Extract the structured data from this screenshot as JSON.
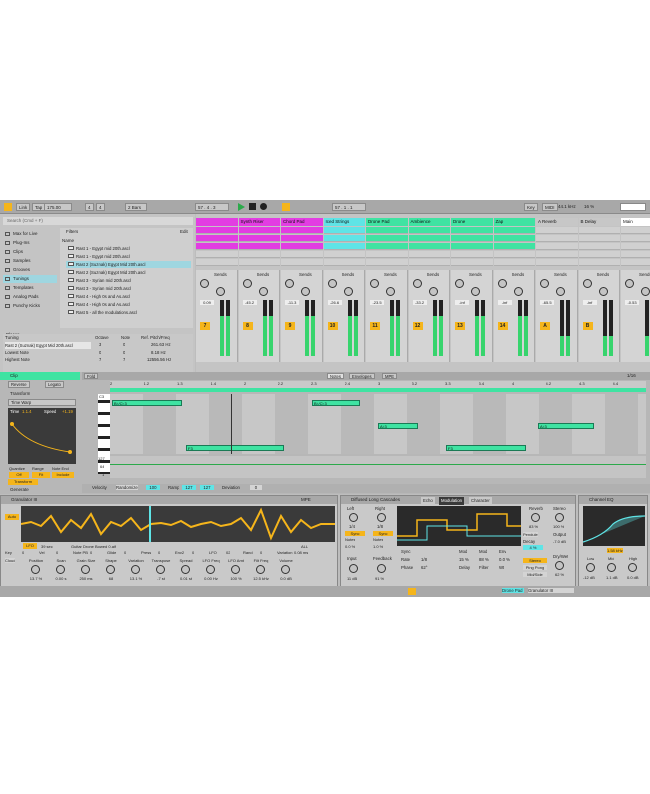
{
  "transport": {
    "link": "Link",
    "tap": "Tap",
    "tempo": "175.00",
    "sig_num": "4",
    "sig_den": "4",
    "quantize": "2 Bars",
    "position": "57 . 4 . 3",
    "position2": "57 . 1 . 1",
    "key": "Key",
    "midi": "MIDI",
    "sample_rate": "44.1 kHz",
    "cpu": "16 %"
  },
  "browser": {
    "search_placeholder": "Search (Cmd + F)",
    "filters": "Filters",
    "edit": "Edit",
    "column_name": "Name",
    "places": [
      {
        "label": "Max for Live"
      },
      {
        "label": "Plug-Ins"
      },
      {
        "label": "Clips"
      },
      {
        "label": "Samples"
      },
      {
        "label": "Grooves"
      },
      {
        "label": "Tunings"
      },
      {
        "label": "Templates"
      },
      {
        "label": "Analog Pads"
      },
      {
        "label": "Punchy Kicks"
      }
    ],
    "places_header": "Places",
    "places_footer": "Packs",
    "files": [
      {
        "name": "Rast 1 - Egypt mid 20th.ascl"
      },
      {
        "name": "Rast 1 - Egypt mid 20th.ascl"
      },
      {
        "name": "Rast 2 (Suznak) Egypt Mid 20th.ascl"
      },
      {
        "name": "Rast 2 (Suznak) Egypt Mid 20th.ascl"
      },
      {
        "name": "Rast 3 - Syrian mid 20th.ascl"
      },
      {
        "name": "Rast 3 - Syrian mid 20th.ascl"
      },
      {
        "name": "Rast 4 - High 0s and As.ascl"
      },
      {
        "name": "Rast 4 - High 0s and As.ascl"
      },
      {
        "name": "Rast 5 - all the modulations.ascl"
      }
    ],
    "tuning": {
      "title": "Tuning",
      "cols": [
        "Octave",
        "Note",
        "Ref. Pitch/Freq"
      ],
      "selected": "Rast 2 (Suznak) Egypt Mid 20th.ascl",
      "row1": [
        "3",
        "0",
        "261.63 Hz"
      ],
      "lowest_label": "Lowest Note",
      "lowest": [
        "0",
        "0",
        "8.18 Hz"
      ],
      "highest_label": "Highest Note",
      "highest": [
        "7",
        "7",
        "12556.56 Hz"
      ]
    }
  },
  "tracks": [
    {
      "name": "",
      "color": "#e23de2",
      "vol": "0.09",
      "num": "7"
    },
    {
      "name": "Synth Riser",
      "color": "#e23de2",
      "vol": "-45.2",
      "num": "8"
    },
    {
      "name": "Chord Pad",
      "color": "#e23de2",
      "vol": "-11.3",
      "num": "9"
    },
    {
      "name": "Iced Strings",
      "color": "#5fe4e6",
      "vol": "-26.6",
      "num": "10"
    },
    {
      "name": "Drone Pad",
      "color": "#3fe3a2",
      "vol": "-23.5",
      "num": "11"
    },
    {
      "name": "Ambience",
      "color": "#3fe3a2",
      "vol": "-33.2",
      "num": "12"
    },
    {
      "name": "Drone",
      "color": "#3fe3a2",
      "vol": "-inf",
      "num": "13"
    },
    {
      "name": "Zap",
      "color": "#3fe3a2",
      "vol": "-inf",
      "num": "14"
    },
    {
      "name": "A Reverb",
      "color": "#c7c7c7",
      "vol": "-65.5",
      "num": "A"
    },
    {
      "name": "B Delay",
      "color": "#c7c7c7",
      "vol": "-inf",
      "num": "B"
    },
    {
      "name": "Main",
      "color": "#ffffff",
      "vol": "-0.53",
      "num": ""
    }
  ],
  "scene_numbers": [
    "1",
    "2",
    "3",
    "4"
  ],
  "sends_label": "Sends",
  "post": "Post",
  "solo": "Solo",
  "clip": {
    "title": "Clip",
    "reverse": "Reverse",
    "legato": "Legato",
    "transform": "Transform",
    "time_warp": "Time Warp",
    "time_label": "Time",
    "time_val": "1.1.4",
    "speed_label": "Speed",
    "speed_val": "+1.19",
    "quantize": "Quantize",
    "range": "Range",
    "note_end": "Note End",
    "off": "Off",
    "fit": "Fit",
    "include": "Include",
    "transform_btn": "Transform",
    "generate": "Generate",
    "fold": "Fold",
    "tabs": [
      "Notes",
      "Envelopes",
      "MPE"
    ],
    "grid": "1/16",
    "ruler": [
      "2",
      "1.2",
      "1.3",
      "1.4",
      "2",
      "2.2",
      "2.3",
      "2.4",
      "3",
      "3.2",
      "3.3",
      "3.4",
      "4",
      "4.2",
      "4.3",
      "4.4"
    ],
    "notes": [
      {
        "label": "B♭/C♭3"
      },
      {
        "label": "B♭/C♭3"
      },
      {
        "label": "A♭3"
      },
      {
        "label": "A♭3"
      },
      {
        "label": "F3"
      },
      {
        "label": "F3"
      }
    ],
    "velocity": "Velocity",
    "randomize": "Randomize",
    "rand_val": "100",
    "ramp": "Ramp",
    "ramp_a": "127",
    "ramp_b": "127",
    "deviation": "Deviation",
    "deviation_val": "0",
    "vel_ticks": [
      "127",
      "64",
      "1"
    ],
    "c3": "C3"
  },
  "granulator": {
    "title": "Granulator III",
    "mpe": "MPE",
    "lfo": "LFO",
    "length": "39 sec",
    "sample": "Guitar Drone Bowed 0.aif",
    "all": "ALL",
    "auto": "Auto",
    "row1": [
      "Key",
      "0",
      "Vel",
      "0",
      "Note PB",
      "0",
      "Glide",
      "0",
      "Press",
      "0",
      "Env2",
      "0",
      "LFO",
      "02",
      "Rand",
      "0",
      "Variation",
      "0.08 ms"
    ],
    "params": [
      {
        "name": "Position",
        "val": "13.7 %"
      },
      {
        "name": "Scan",
        "val": "0.00 s"
      },
      {
        "name": "Grain Size",
        "val": "250 ms"
      },
      {
        "name": "Shape",
        "val": "68"
      },
      {
        "name": "Variation",
        "val": "13.1 %"
      },
      {
        "name": "Transpose",
        "val": "-7 st"
      },
      {
        "name": "Spread",
        "val": "0.01 st"
      },
      {
        "name": "LFO Freq",
        "val": "0.00 Hz"
      },
      {
        "name": "LFO Amt",
        "val": "100 %"
      },
      {
        "name": "Filt Freq",
        "val": "12.5 kHz"
      },
      {
        "name": "Volume",
        "val": "0.0 dB"
      }
    ],
    "mode": "Cloud",
    "voices": "Voices",
    "voices_val": "1 / 8",
    "mono": "Mono",
    "time": "1.00 ms",
    "hold": "Hold"
  },
  "cascades": {
    "title": "Diffused Long Cascades",
    "tabs": [
      "Echo",
      "Modulation",
      "Character"
    ],
    "left": "Left",
    "right": "Right",
    "left_val": "1/4",
    "right_val": "1/8",
    "sync": "Sync",
    "notes": "Notes",
    "l_pct": "0.0 %",
    "r_pct": "1.0 %",
    "input": "Input",
    "input_val": "11 dB",
    "feedback": "Feedback",
    "feedback_val": "91 %",
    "rate": "Rate",
    "rate_val": "1/8",
    "phase": "Phase",
    "phase_val": "62°",
    "mod": "Mod",
    "mod_val": "15 %",
    "mod2": "Mod",
    "mod2_val": "88 %",
    "env": "Env",
    "env_val": "0.0 %",
    "delay": "Delay",
    "filter": "Filter",
    "wet": "Wt",
    "reverb": "Reverb",
    "reverb_val": "83 %",
    "stereo": "Stereo",
    "stereo_val": "100 %",
    "output": "Output",
    "output_val": "-7.0 dB",
    "decay": "Decay",
    "decay_val": "4 %",
    "dry_wet": "Dry/Wet",
    "dry_wet_val": "62 %",
    "pingpong": "Ping Pong",
    "midside": "Mid/Side",
    "stereo_btn": "Stereo",
    "pendule": "Pendule"
  },
  "eq": {
    "title": "Channel EQ",
    "freq": "1.58 kHz",
    "bands": [
      {
        "name": "Low",
        "val": "-12 dB"
      },
      {
        "name": "Mid",
        "val": "1.1 dB"
      },
      {
        "name": "High",
        "val": "0.0 dB"
      }
    ]
  },
  "status": {
    "track": "Drone Pad",
    "device": "Granulator III"
  }
}
